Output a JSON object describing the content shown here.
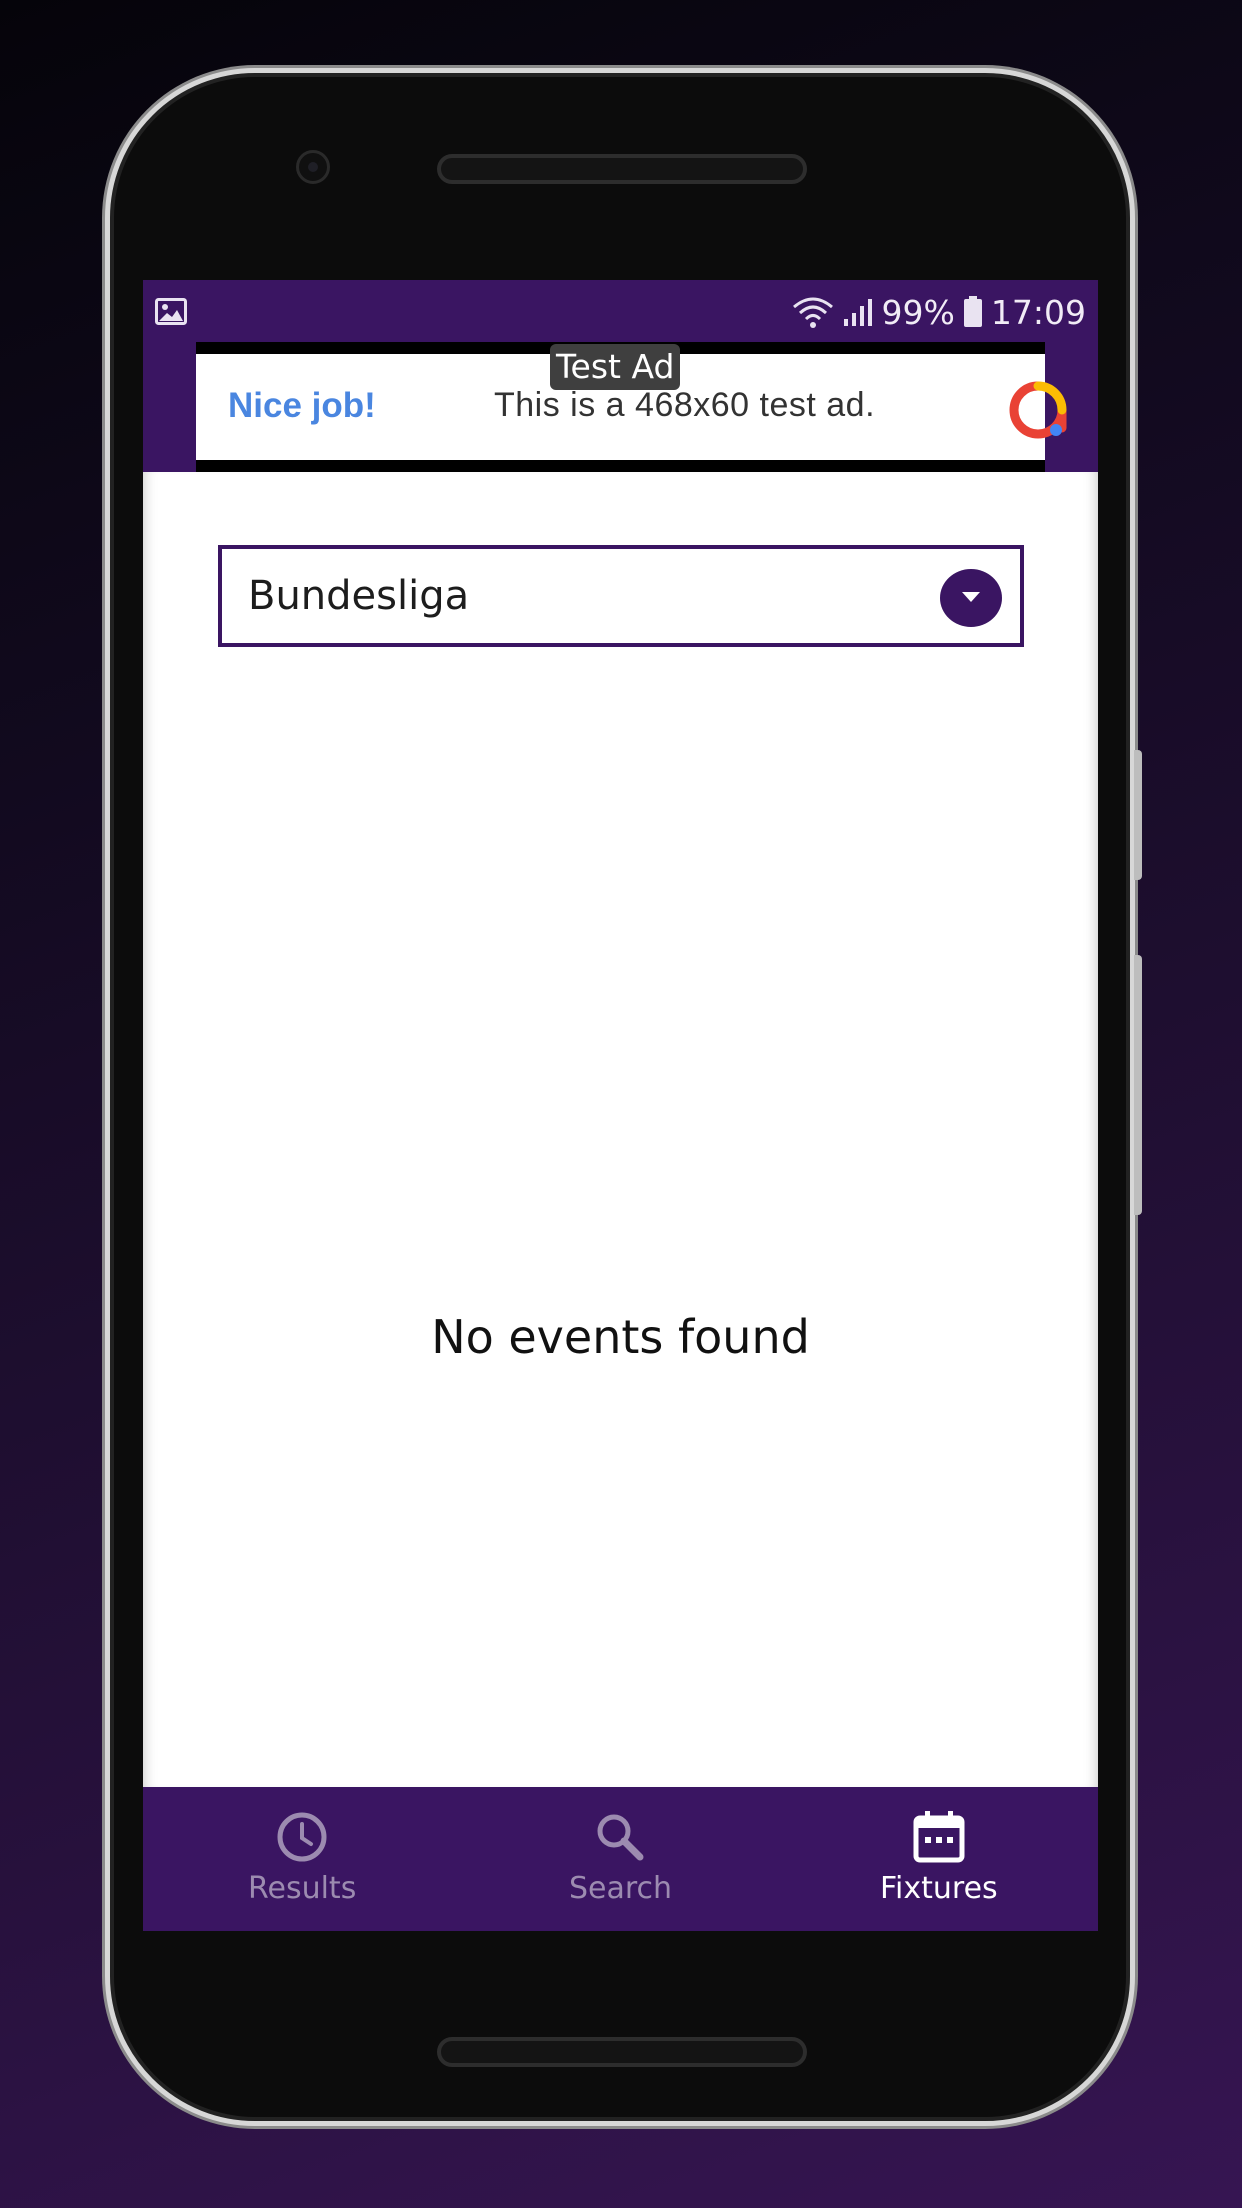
{
  "status_bar": {
    "signal": "99%",
    "time": "17:09"
  },
  "ad": {
    "label": "Test Ad",
    "headline": "Nice job!",
    "text": "This is a 468x60 test ad."
  },
  "league_select": {
    "selected": "Bundesliga"
  },
  "content": {
    "empty_message": "No events found"
  },
  "bottom_nav": {
    "items": [
      {
        "label": "Results",
        "icon": "clock-icon",
        "active": false
      },
      {
        "label": "Search",
        "icon": "search-icon",
        "active": false
      },
      {
        "label": "Fixtures",
        "icon": "calendar-icon",
        "active": true
      }
    ]
  },
  "colors": {
    "primary": "#3a1562",
    "ad_headline": "#4a86e0",
    "inactive_nav": "#9c8bb0",
    "active_nav": "#ffffff"
  }
}
